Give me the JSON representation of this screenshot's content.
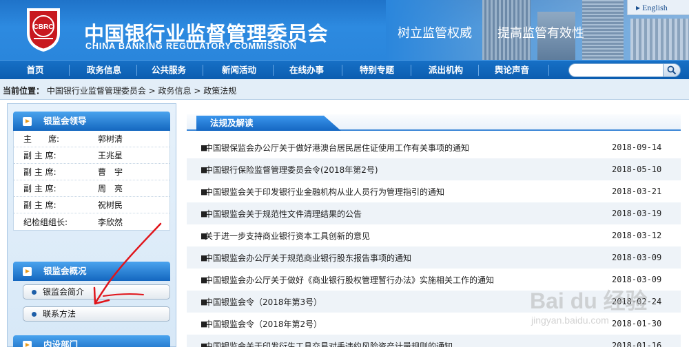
{
  "header": {
    "title_cn": "中国银行业监督管理委员会",
    "title_en": "CHINA BANKING REGULATORY COMMISSION",
    "emblem_text": "CBRC",
    "slogan_left": "树立监管权威",
    "slogan_right": "提高监管有效性",
    "lang_link": "▸ English",
    "colors": {
      "brand_blue": "#2a86dc",
      "nav_blue": "#0b5db0",
      "accent_orange": "#e89a1a"
    }
  },
  "nav": {
    "items": [
      {
        "label": "首页"
      },
      {
        "label": "政务信息"
      },
      {
        "label": "公共服务"
      },
      {
        "label": "新闻活动"
      },
      {
        "label": "在线办事"
      },
      {
        "label": "特别专题"
      },
      {
        "label": "派出机构"
      },
      {
        "label": "舆论声音"
      }
    ],
    "search_value": "",
    "search_icon": "magnifier-icon"
  },
  "breadcrumb": {
    "lead": "当前位置：",
    "path": "中国银行业监督管理委员会 > 政务信息 > 政策法规"
  },
  "sidebar": {
    "leaders_title": "银监会领导",
    "leaders": [
      {
        "role": "主　　席:",
        "name": "郭树清"
      },
      {
        "role": "副 主 席:",
        "name": "王兆星"
      },
      {
        "role": "副 主 席:",
        "name": "曹　宇"
      },
      {
        "role": "副 主 席:",
        "name": "周　亮"
      },
      {
        "role": "副 主 席:",
        "name": "祝树民"
      },
      {
        "role": "纪检组组长:",
        "name": "李欣然"
      }
    ],
    "overview_title": "银监会概况",
    "overview_links": [
      {
        "label": "银监会简介"
      },
      {
        "label": "联系方法"
      }
    ],
    "dept_title": "内设部门"
  },
  "main": {
    "tab_label": "法规及解读",
    "news": [
      {
        "title": "中国银保监会办公厅关于做好港澳台居民居住证使用工作有关事项的通知",
        "date": "2018-09-14"
      },
      {
        "title": "中国银行保险监督管理委员会令(2018年第2号)",
        "date": "2018-05-10"
      },
      {
        "title": "中国银监会关于印发银行业金融机构从业人员行为管理指引的通知",
        "date": "2018-03-21"
      },
      {
        "title": "中国银监会关于规范性文件清理结果的公告",
        "date": "2018-03-19"
      },
      {
        "title": "关于进一步支持商业银行资本工具创新的意见",
        "date": "2018-03-12"
      },
      {
        "title": "中国银监会办公厅关于规范商业银行股东报告事项的通知",
        "date": "2018-03-09"
      },
      {
        "title": "中国银监会办公厅关于做好《商业银行股权管理暂行办法》实施相关工作的通知",
        "date": "2018-03-09"
      },
      {
        "title": "中国银监会令（2018年第3号）",
        "date": "2018-02-24"
      },
      {
        "title": "中国银监会令（2018年第2号）",
        "date": "2018-01-30"
      },
      {
        "title": "中国银监会关于印发衍生工具交易对手违约风险资产计量规则的通知",
        "date": "2018-01-16"
      }
    ]
  },
  "watermark": {
    "brand": "Bai du 经验",
    "url": "jingyan.baidu.com"
  }
}
